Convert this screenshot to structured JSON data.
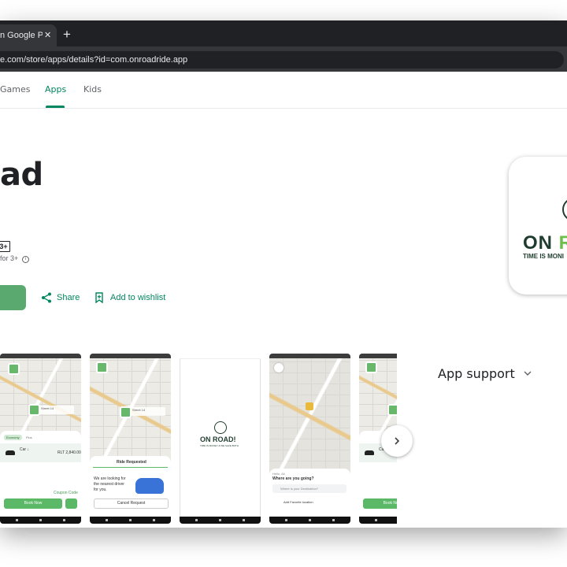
{
  "browser": {
    "tab_title": "n Google Pla",
    "tab_close": "✕",
    "new_tab": "+",
    "url": "e.com/store/apps/details?id=com.onroadride.app"
  },
  "nav": {
    "items": [
      {
        "label": "Games"
      },
      {
        "label": "Apps"
      },
      {
        "label": "Kids"
      }
    ],
    "active": "Apps"
  },
  "app": {
    "title_fragment": "ad",
    "content_rating": "3+",
    "rated_for": "for 3+",
    "share_label": "Share",
    "wishlist_label": "Add to wishlist",
    "icon_word_a": "ON ",
    "icon_word_b": "R",
    "icon_tagline": "TIME IS MONI"
  },
  "screenshots": {
    "shot1": {
      "tab_economy": "Economy",
      "tab_plus": "Plus",
      "car_label": "Car ↓",
      "price": "RLT 2,840.00",
      "coupon": "Coupon Code",
      "book_btn": "Book Now"
    },
    "shot2": {
      "heading": "Ride Requested",
      "message": "We are looking for the nearest driver for you.",
      "cancel_btn": "Cancel Request"
    },
    "shot3": {
      "logo": "ON ROAD!",
      "tagline": "TIME IS MONEY & WE SAVE BOTH"
    },
    "shot4": {
      "greeting": "Hello, Ali",
      "question": "Where are you going?",
      "search_placeholder": "Where is your Destination?",
      "favorite": "Add Favorite location"
    },
    "shot5": {
      "car_label": "Car ↓",
      "book_btn": "Book Now"
    }
  },
  "support": {
    "label": "App support"
  },
  "colors": {
    "accent": "#01875f",
    "install": "#5aa96f",
    "brand_green": "#6cc04a",
    "brand_dark": "#1f3d2e"
  },
  "icons": [
    "close-icon",
    "plus-icon",
    "share-icon",
    "bookmark-icon",
    "info-icon",
    "chevron-right-icon",
    "chevron-down-icon"
  ]
}
